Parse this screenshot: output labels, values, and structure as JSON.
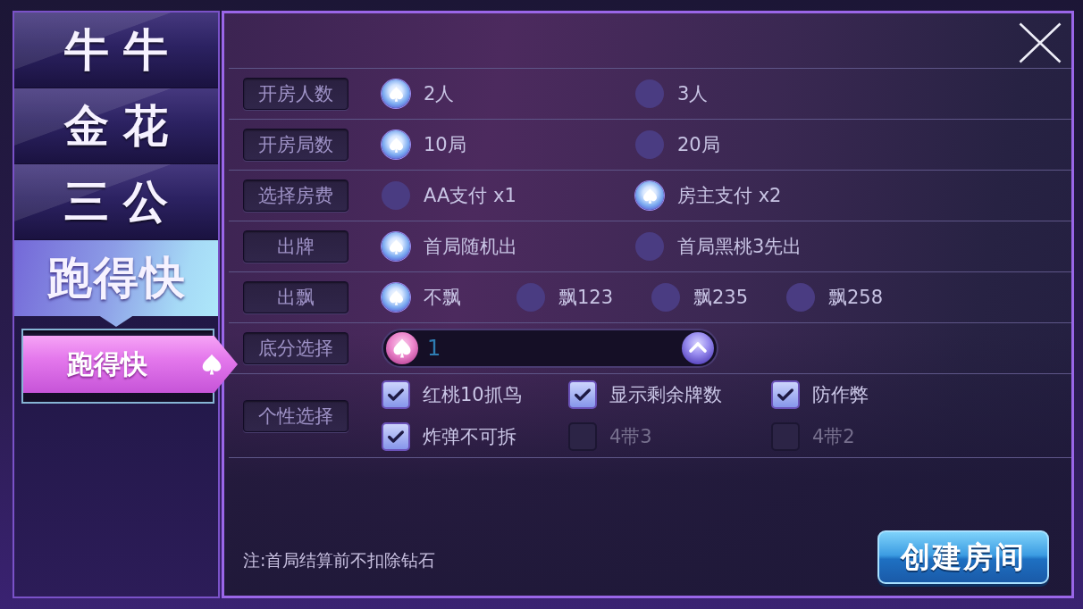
{
  "game_tabs": [
    {
      "label": "牛牛",
      "selected": false
    },
    {
      "label": "金花",
      "selected": false
    },
    {
      "label": "三公",
      "selected": false
    },
    {
      "label": "跑得快",
      "selected": true
    }
  ],
  "sub_modes": [
    {
      "label": "跑得快",
      "selected": true
    }
  ],
  "settings": [
    {
      "kind": "radio",
      "label": "开房人数",
      "options": [
        {
          "label": "2人",
          "selected": true
        },
        {
          "label": "3人",
          "selected": false
        }
      ]
    },
    {
      "kind": "radio",
      "label": "开房局数",
      "options": [
        {
          "label": "10局",
          "selected": true
        },
        {
          "label": "20局",
          "selected": false
        }
      ]
    },
    {
      "kind": "radio",
      "label": "选择房费",
      "options": [
        {
          "label": "AA支付 x1",
          "selected": false
        },
        {
          "label": "房主支付 x2",
          "selected": true
        }
      ]
    },
    {
      "kind": "radio",
      "label": "出牌",
      "options": [
        {
          "label": "首局随机出",
          "selected": true
        },
        {
          "label": "首局黑桃3先出",
          "selected": false
        }
      ]
    },
    {
      "kind": "radio",
      "label": "出飘",
      "options": [
        {
          "label": "不飘",
          "selected": true
        },
        {
          "label": "飘123",
          "selected": false
        },
        {
          "label": "飘235",
          "selected": false
        },
        {
          "label": "飘258",
          "selected": false
        }
      ]
    },
    {
      "kind": "dropdown",
      "label": "底分选择",
      "value": "1"
    },
    {
      "kind": "checkbox",
      "label": "个性选择",
      "options": [
        {
          "label": "红桃10抓鸟",
          "checked": true
        },
        {
          "label": "显示剩余牌数",
          "checked": true
        },
        {
          "label": "防作弊",
          "checked": true
        },
        {
          "label": "炸弹不可拆",
          "checked": true
        },
        {
          "label": "4带3",
          "checked": false
        },
        {
          "label": "4带2",
          "checked": false
        }
      ]
    }
  ],
  "note": "注:首局结算前不扣除钻石",
  "create_button": "创建房间"
}
